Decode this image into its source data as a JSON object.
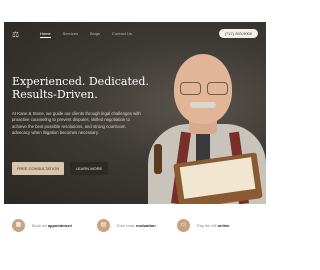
{
  "nav": {
    "logo_icon": "scales-of-justice-icon",
    "links": [
      {
        "label": "Home",
        "active": true
      },
      {
        "label": "Services",
        "active": false
      },
      {
        "label": "Blogs",
        "active": false
      },
      {
        "label": "Contact Us",
        "active": false
      }
    ],
    "phone": "(717) 263-9000"
  },
  "hero": {
    "headline_line1": "Experienced. Dedicated.",
    "headline_line2": "Results-Driven.",
    "intro": "At Kane & Stone, we guide our clients through legal challenges with proactive counseling to prevent disputes, skilled negotiation to achieve the best possible resolutions, and strong courtroom advocacy when litigation becomes necessary.",
    "primary_cta": "FREE CONSULTATION",
    "secondary_cta": "LEARN MORE"
  },
  "features": [
    {
      "prefix": "Book an",
      "emphasis": "appointment",
      "icon": "calendar-icon",
      "color": "#c9a27e"
    },
    {
      "prefix": "Free case",
      "emphasis": "evaluation",
      "icon": "document-icon",
      "color": "#c9a27e"
    },
    {
      "prefix": "Pay the bill",
      "emphasis": "online",
      "icon": "credit-card-icon",
      "color": "#c9a27e"
    }
  ],
  "colors": {
    "hero_background": "#3d3934",
    "accent": "#d8c7ad",
    "icon_circle": "#c9a27e"
  }
}
